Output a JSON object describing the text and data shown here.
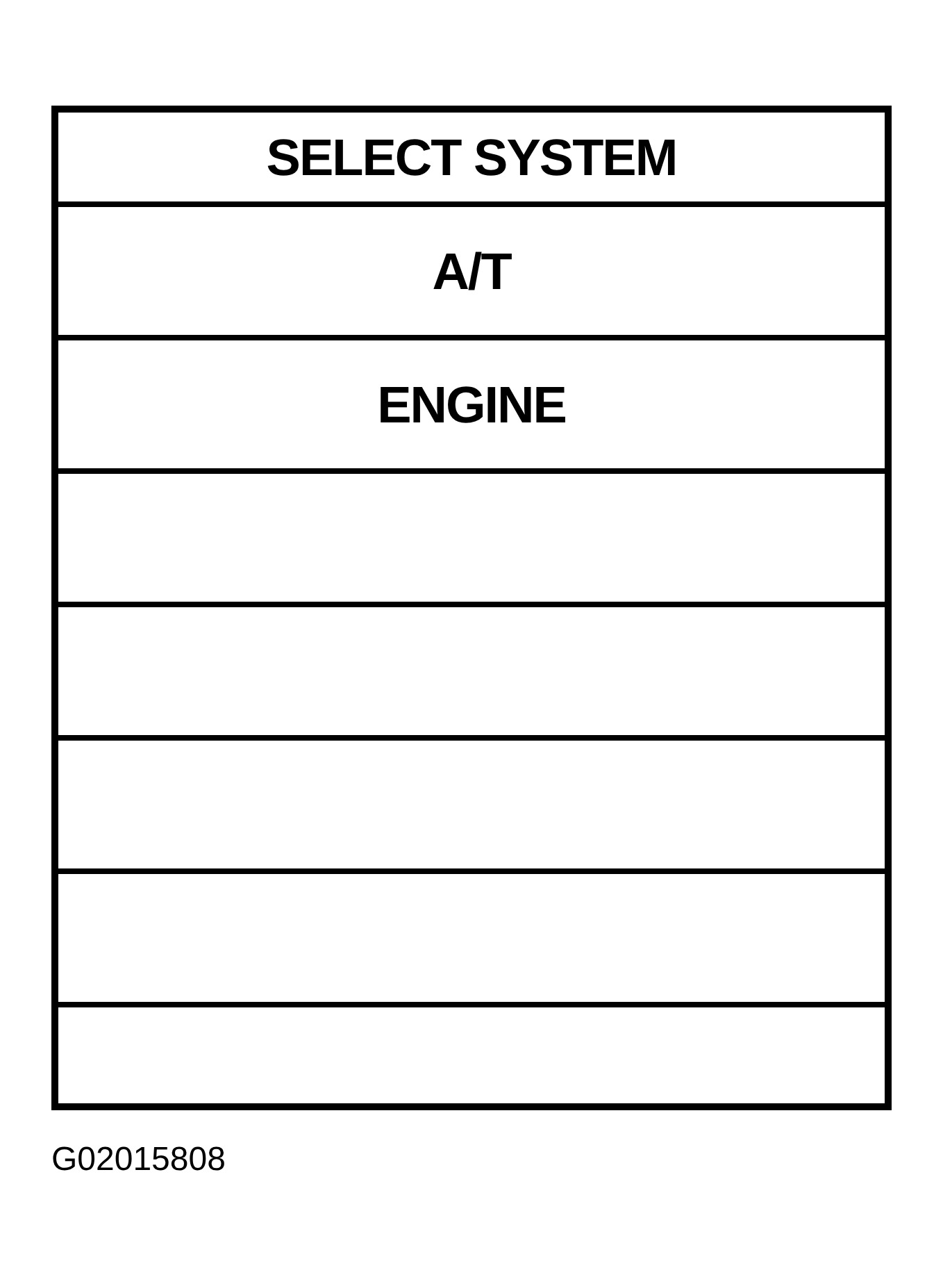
{
  "screen": {
    "title": "SELECT SYSTEM",
    "rows": [
      {
        "kind": "item",
        "label": "A/T"
      },
      {
        "kind": "item",
        "label": "ENGINE"
      },
      {
        "kind": "blank"
      },
      {
        "kind": "blank"
      },
      {
        "kind": "blank"
      },
      {
        "kind": "blank"
      },
      {
        "kind": "blank"
      }
    ]
  },
  "figure_id": "G02015808"
}
